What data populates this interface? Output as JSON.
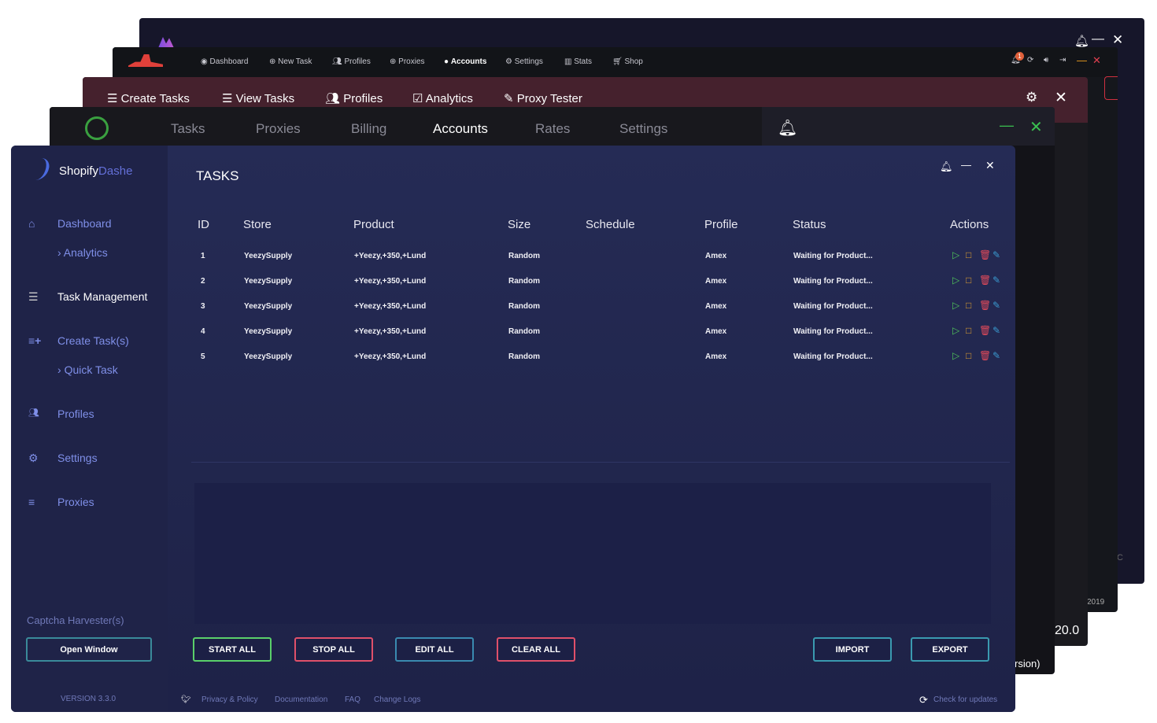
{
  "window_a": {
    "icons": [
      "bell-icon",
      "minimize-icon",
      "close-icon"
    ],
    "partial_text": "C"
  },
  "window_b": {
    "nav": [
      "Dashboard",
      "New Task",
      "Profiles",
      "Proxies",
      "Accounts",
      "Settings",
      "Stats",
      "Shop"
    ],
    "active": "Accounts",
    "notification_count": "1",
    "partial_text": "2019"
  },
  "window_c": {
    "nav": [
      "Create Tasks",
      "View Tasks",
      "Profiles",
      "Analytics",
      "Proxy Tester"
    ],
    "partial_text": "20.0"
  },
  "window_d": {
    "nav": [
      "Tasks",
      "Proxies",
      "Billing",
      "Accounts",
      "Rates",
      "Settings"
    ],
    "active": "Accounts",
    "partial_text": "rsion)"
  },
  "main": {
    "brand": {
      "first": "Shopify",
      "second": "Dashe"
    },
    "title": "TASKS",
    "sidebar": {
      "dashboard": "Dashboard",
      "analytics": "Analytics",
      "task_management": "Task Management",
      "create_tasks": "Create Task(s)",
      "quick_task": "Quick Task",
      "profiles": "Profiles",
      "settings": "Settings",
      "proxies": "Proxies",
      "captcha_label": "Captcha Harvester(s)",
      "open_window": "Open Window",
      "version": "VERSION 3.3.0"
    },
    "table": {
      "columns": [
        "ID",
        "Store",
        "Product",
        "Size",
        "Schedule",
        "Profile",
        "Status",
        "Actions"
      ],
      "rows": [
        {
          "id": "1",
          "store": "YeezySupply",
          "product": "+Yeezy,+350,+Lund",
          "size": "Random",
          "schedule": "",
          "profile": "Amex",
          "status": "Waiting for Product..."
        },
        {
          "id": "2",
          "store": "YeezySupply",
          "product": "+Yeezy,+350,+Lund",
          "size": "Random",
          "schedule": "",
          "profile": "Amex",
          "status": "Waiting for Product..."
        },
        {
          "id": "3",
          "store": "YeezySupply",
          "product": "+Yeezy,+350,+Lund",
          "size": "Random",
          "schedule": "",
          "profile": "Amex",
          "status": "Waiting for Product..."
        },
        {
          "id": "4",
          "store": "YeezySupply",
          "product": "+Yeezy,+350,+Lund",
          "size": "Random",
          "schedule": "",
          "profile": "Amex",
          "status": "Waiting for Product..."
        },
        {
          "id": "5",
          "store": "YeezySupply",
          "product": "+Yeezy,+350,+Lund",
          "size": "Random",
          "schedule": "",
          "profile": "Amex",
          "status": "Waiting for Product..."
        }
      ]
    },
    "buttons": {
      "start_all": "START ALL",
      "stop_all": "STOP ALL",
      "edit_all": "EDIT ALL",
      "clear_all": "CLEAR ALL",
      "import": "IMPORT",
      "export": "EXPORT"
    },
    "footer": {
      "privacy": "Privacy & Policy",
      "docs": "Documentation",
      "faq": "FAQ",
      "changelog": "Change Logs",
      "check_updates": "Check for updates"
    },
    "colors": {
      "accent": "#7f8fe8",
      "play": "#4fc35a",
      "stop": "#e0a030",
      "delete": "#e04a5a",
      "edit": "#3a9ad0"
    }
  }
}
